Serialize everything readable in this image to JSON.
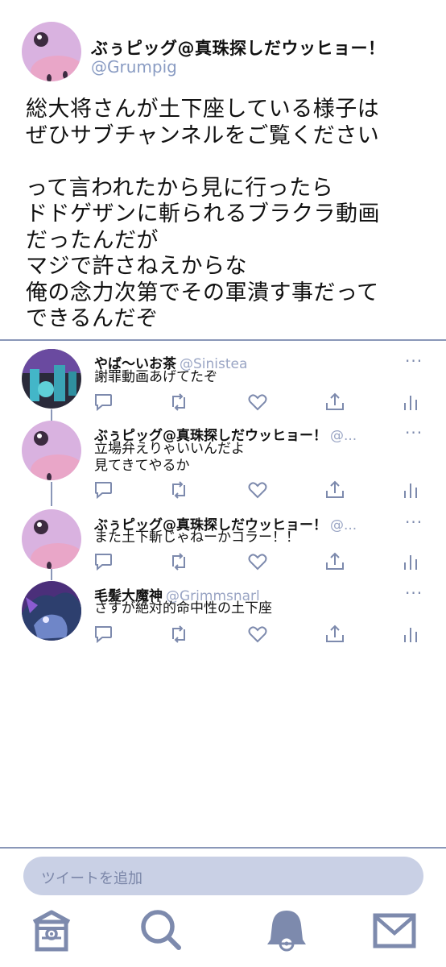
{
  "main_tweet": {
    "name": "ぶぅピッグ@真珠探しだウッヒョー！",
    "handle": "@Grumpig",
    "body": "総大将さんが土下座している様子は\nぜひサブチャンネルをご覧ください\n\nって言われたから見に行ったら\nドドゲザンに斬られるブラクラ動画\nだったんだが\nマジで許さねえからな\n俺の念力次第でその軍潰す事だって\nできるんだぞ",
    "avatar_icon": "grumpig-avatar-icon"
  },
  "replies": [
    {
      "name": "やば〜いお茶",
      "handle": "@Sinistea",
      "text": "謝罪動画あげてたぞ",
      "more": "···",
      "avatar_icon": "sinistea-avatar-icon"
    },
    {
      "name": "ぶぅピッグ@真珠探しだウッヒョー！",
      "handle": "@...",
      "text": "立場弁えりゃいいんだよ\n見てきてやるか",
      "more": "···",
      "avatar_icon": "grumpig-avatar-icon"
    },
    {
      "name": "ぶぅピッグ@真珠探しだウッヒョー！",
      "handle": "@...",
      "text": "また土下斬じゃねーかコラー！！",
      "more": "···",
      "avatar_icon": "grumpig-avatar-icon"
    },
    {
      "name": "毛髪大魔神",
      "handle": "@Grimmsnarl",
      "text": "さすが絶対的命中性の土下座",
      "more": "···",
      "avatar_icon": "grimmsnarl-avatar-icon"
    }
  ],
  "actions": [
    "reply-icon",
    "retweet-icon",
    "like-icon",
    "share-icon",
    "analytics-icon"
  ],
  "compose": {
    "placeholder": "ツイートを追加"
  },
  "nav": [
    "home-icon",
    "search-icon",
    "notifications-icon",
    "messages-icon"
  ],
  "colors": {
    "accent": "#8a97b8",
    "handle": "#8a9cc3",
    "icon": "#7d8aad",
    "compose_bg": "#c9d0e5"
  }
}
